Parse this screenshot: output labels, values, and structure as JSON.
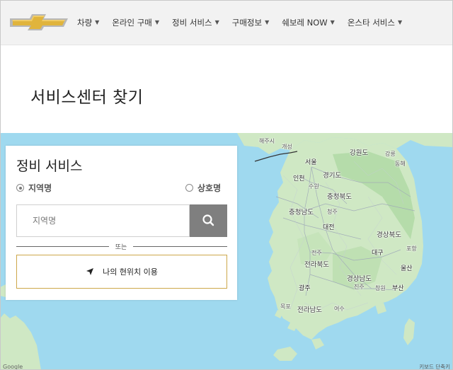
{
  "brand": {
    "logo_icon": "chevrolet-bowtie-icon",
    "gold": "#d4a93a"
  },
  "nav": {
    "items": [
      {
        "label": "차량"
      },
      {
        "label": "온라인 구매"
      },
      {
        "label": "정비 서비스"
      },
      {
        "label": "구매정보"
      },
      {
        "label": "쉐보레 NOW"
      },
      {
        "label": "온스타 서비스"
      }
    ],
    "caret_icon": "caret-down-icon"
  },
  "page": {
    "title": "서비스센터 찾기"
  },
  "panel": {
    "title": "정비 서비스",
    "radio_region_label": "지역명",
    "radio_name_label": "상호명",
    "selected": "지역명",
    "search_placeholder": "지역명",
    "search_value": "",
    "search_icon": "search-icon",
    "divider_text": "또는",
    "location_button_label": "나의 현위치 이용",
    "location_icon": "location-arrow-icon"
  },
  "map": {
    "labels": {
      "haeju": "해주시",
      "kaesong": "개성",
      "gangwon": "강원도",
      "gangneung": "강릉",
      "donghae": "동해",
      "seoul": "서울",
      "incheon": "인천",
      "suwon": "수원",
      "gyeonggi": "경기도",
      "chungbuk": "충청북도",
      "chungnam": "충청남도",
      "cheongju": "청주",
      "daejeon": "대전",
      "gyeongbuk": "경상북도",
      "jeonju": "전주",
      "jeonbuk": "전라북도",
      "daegu": "대구",
      "pohang": "포항",
      "ulsan": "울산",
      "gyeongnam": "경상남도",
      "jinju": "진주",
      "changwon": "창원",
      "busan": "부산",
      "gwangju": "광주",
      "mokpo": "목포",
      "jeonnam": "전라남도",
      "yeosu": "여수",
      "google": "Google",
      "terms": "키보드 단축키"
    },
    "colors": {
      "sea": "#9fd9ef",
      "land": "#cfe8c4",
      "land_dark": "#b5dcaa"
    }
  }
}
